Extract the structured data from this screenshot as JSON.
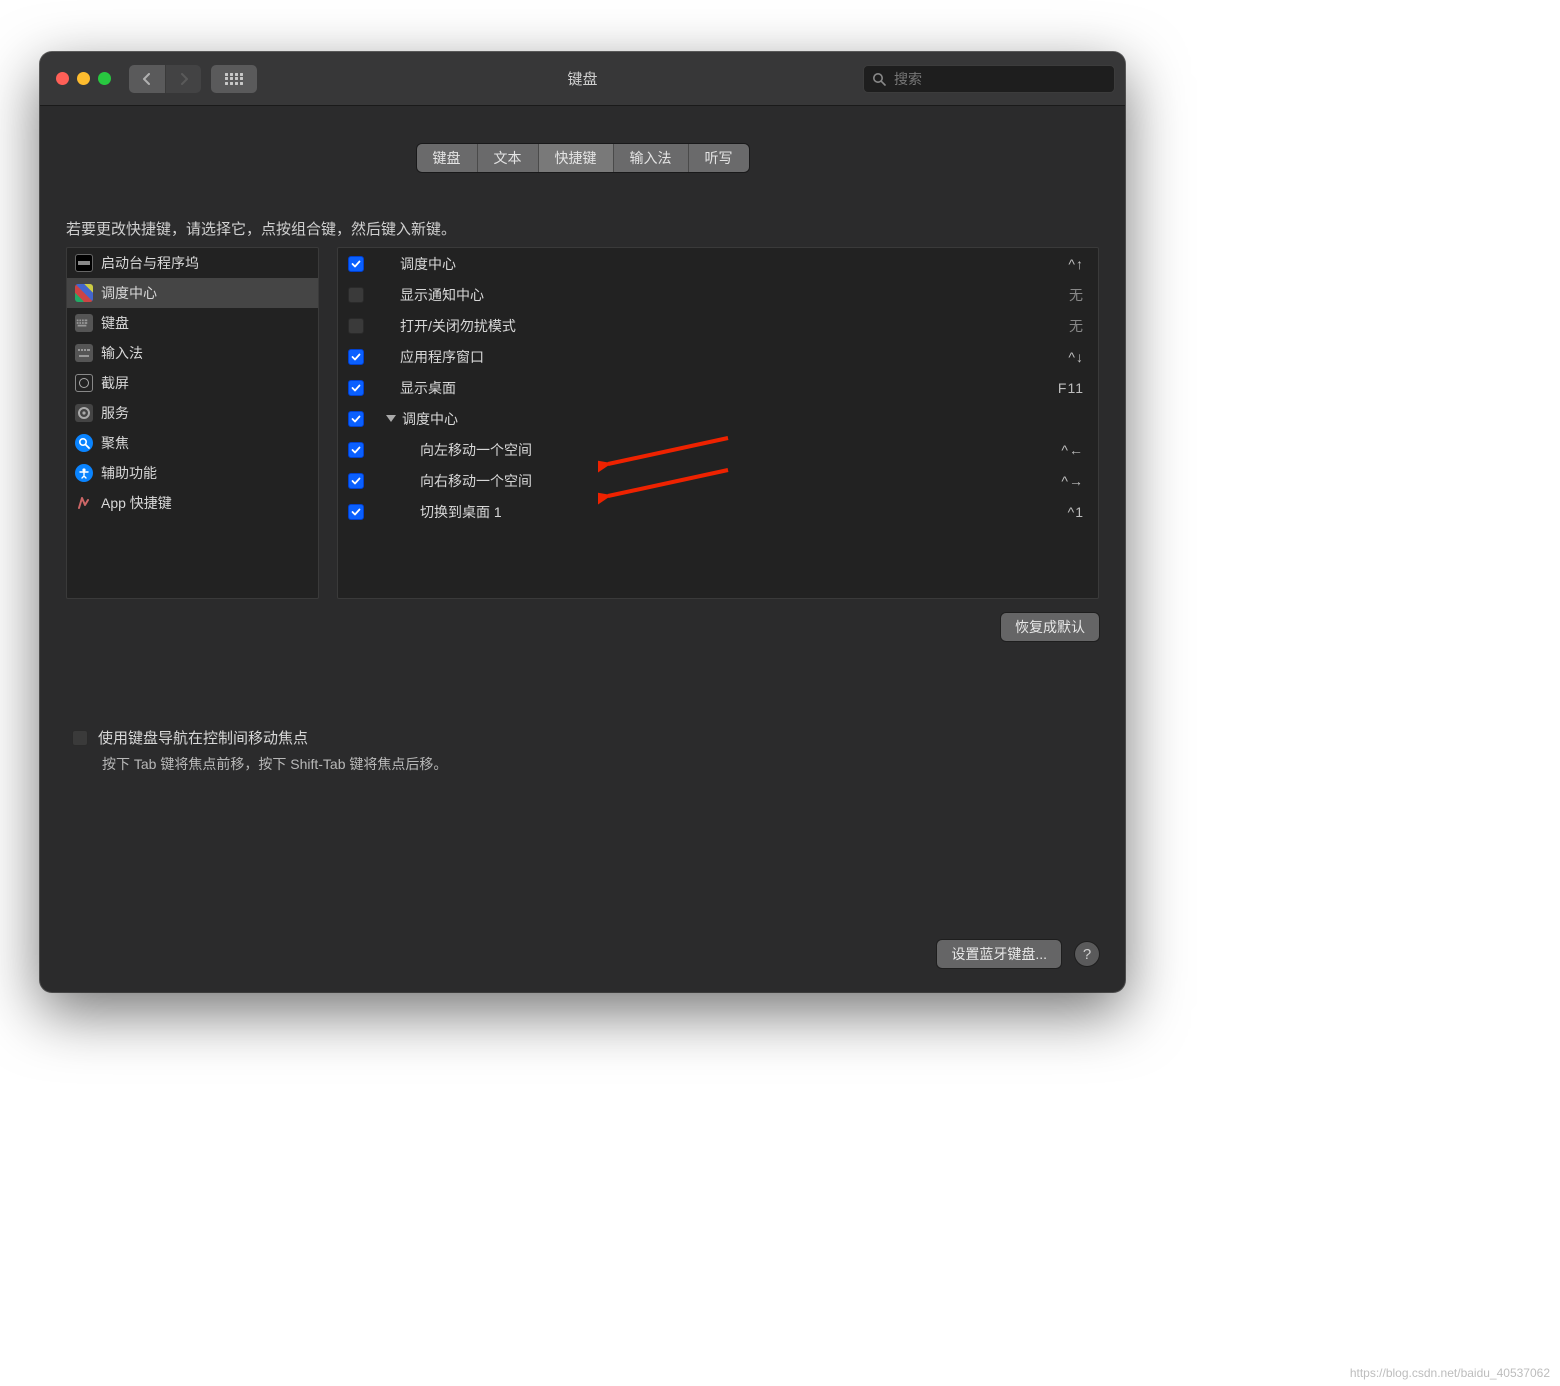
{
  "window": {
    "title": "键盘"
  },
  "search": {
    "placeholder": "搜索"
  },
  "tabs": [
    {
      "label": "键盘",
      "active": false
    },
    {
      "label": "文本",
      "active": false
    },
    {
      "label": "快捷键",
      "active": true
    },
    {
      "label": "输入法",
      "active": false
    },
    {
      "label": "听写",
      "active": false
    }
  ],
  "instruction": "若要更改快捷键，请选择它，点按组合键，然后键入新键。",
  "categories": [
    {
      "label": "启动台与程序坞",
      "icon": "launchpad",
      "selected": false
    },
    {
      "label": "调度中心",
      "icon": "mission",
      "selected": true
    },
    {
      "label": "键盘",
      "icon": "keyboard",
      "selected": false
    },
    {
      "label": "输入法",
      "icon": "input",
      "selected": false
    },
    {
      "label": "截屏",
      "icon": "screenshot",
      "selected": false
    },
    {
      "label": "服务",
      "icon": "services",
      "selected": false
    },
    {
      "label": "聚焦",
      "icon": "spotlight",
      "selected": false
    },
    {
      "label": "辅助功能",
      "icon": "access",
      "selected": false
    },
    {
      "label": "App 快捷键",
      "icon": "app",
      "selected": false
    }
  ],
  "shortcuts": [
    {
      "checked": true,
      "label": "调度中心",
      "shortcut": "^↑",
      "indent": 1,
      "group": false
    },
    {
      "checked": false,
      "label": "显示通知中心",
      "shortcut": "无",
      "indent": 1,
      "group": false,
      "dim": true
    },
    {
      "checked": false,
      "label": "打开/关闭勿扰模式",
      "shortcut": "无",
      "indent": 1,
      "group": false,
      "dim": true
    },
    {
      "checked": true,
      "label": "应用程序窗口",
      "shortcut": "^↓",
      "indent": 1,
      "group": false
    },
    {
      "checked": true,
      "label": "显示桌面",
      "shortcut": "F11",
      "indent": 1,
      "group": false
    },
    {
      "checked": true,
      "label": "调度中心",
      "shortcut": "",
      "indent": 1,
      "group": true
    },
    {
      "checked": true,
      "label": "向左移动一个空间",
      "shortcut": "^←",
      "indent": 2,
      "group": false,
      "arrow": true
    },
    {
      "checked": true,
      "label": "向右移动一个空间",
      "shortcut": "^→",
      "indent": 2,
      "group": false,
      "arrow": true
    },
    {
      "checked": true,
      "label": "切换到桌面 1",
      "shortcut": "^1",
      "indent": 2,
      "group": false
    }
  ],
  "restore_button": "恢复成默认",
  "keyboard_nav": {
    "checkbox_label": "使用键盘导航在控制间移动焦点",
    "description": "按下 Tab 键将焦点前移，按下 Shift-Tab 键将焦点后移。"
  },
  "bluetooth_button": "设置蓝牙键盘...",
  "help_label": "?",
  "watermark": "https://blog.csdn.net/baidu_40537062"
}
